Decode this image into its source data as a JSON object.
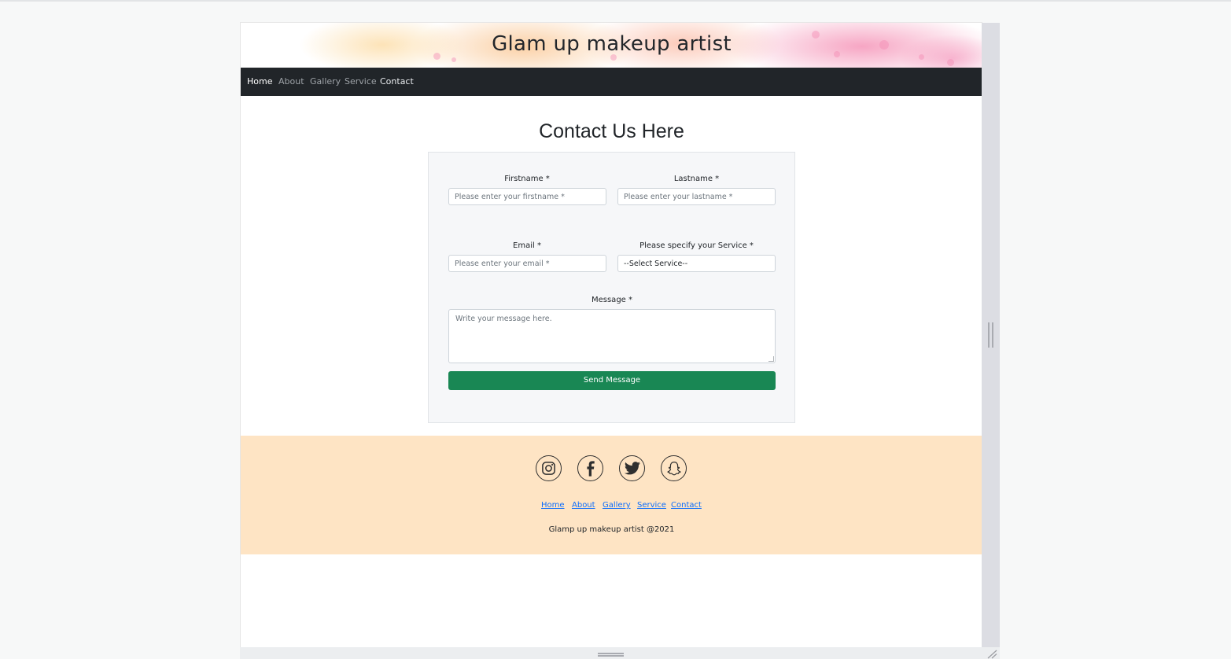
{
  "site": {
    "title": "Glam up makeup artist"
  },
  "nav": {
    "items": [
      {
        "label": "Home",
        "active": true
      },
      {
        "label": "About",
        "active": false
      },
      {
        "label": "Gallery",
        "active": false
      },
      {
        "label": "Service",
        "active": false
      },
      {
        "label": "Contact",
        "active": false
      }
    ]
  },
  "contact": {
    "heading": "Contact Us Here",
    "firstname_label": "Firstname *",
    "firstname_placeholder": "Please enter your firstname *",
    "lastname_label": "Lastname *",
    "lastname_placeholder": "Please enter your lastname *",
    "email_label": "Email *",
    "email_placeholder": "Please enter your email *",
    "service_label": "Please specify your Service *",
    "service_selected": "--Select Service--",
    "message_label": "Message *",
    "message_placeholder": "Write your message here.",
    "send_label": "Send Message"
  },
  "footer": {
    "social": [
      "instagram-icon",
      "facebook-icon",
      "twitter-icon",
      "snapchat-icon"
    ],
    "links": [
      "Home",
      "About",
      "Gallery",
      "Service",
      "Contact"
    ],
    "copyright": "Glamp up makeup artist @2021"
  },
  "colors": {
    "navbar": "#212529",
    "send_button": "#198754",
    "footer_bg": "#fee4c4",
    "link": "#0d6efd"
  }
}
